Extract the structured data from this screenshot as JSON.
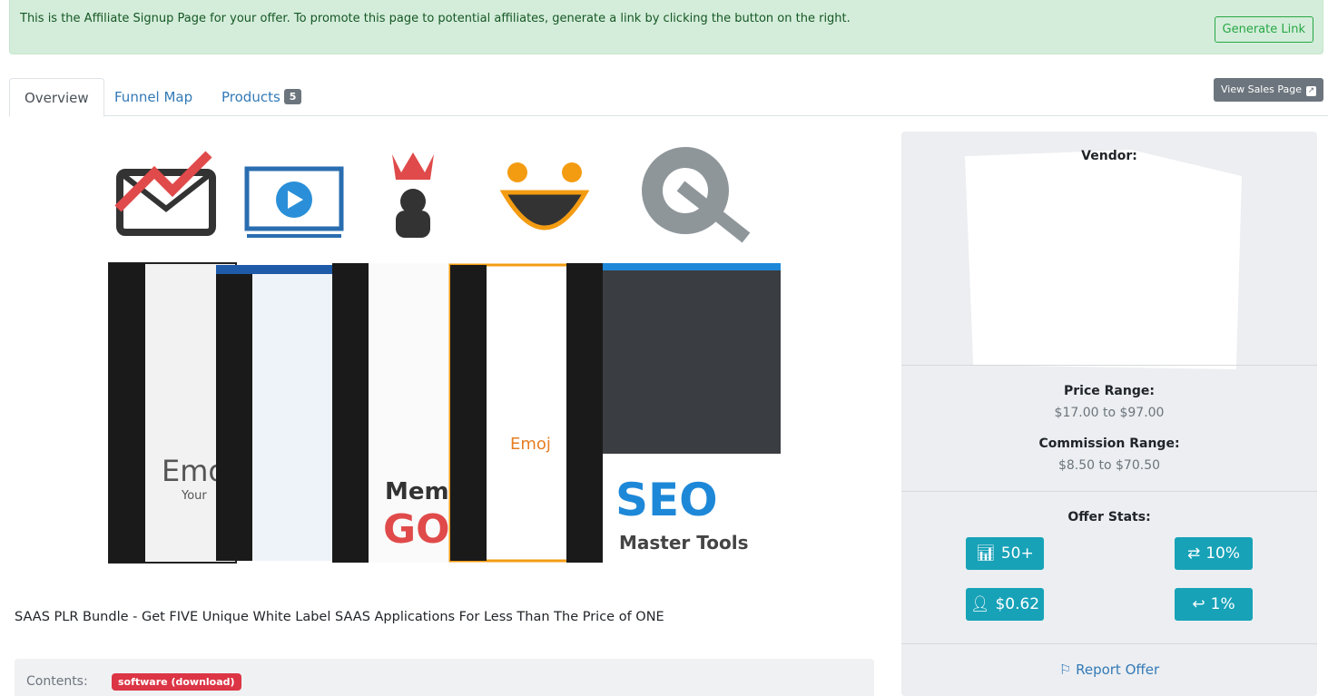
{
  "alert": {
    "text": "This is the Affiliate Signup Page for your offer. To promote this page to potential affiliates, generate a link by clicking the button on the right.",
    "button": "Generate Link"
  },
  "tabs": [
    {
      "label": "Overview",
      "active": true
    },
    {
      "label": "Funnel Map"
    },
    {
      "label": "Products",
      "badge": "5"
    }
  ],
  "view_sales_page": "View Sales Page",
  "product": {
    "title": "SAAS PLR Bundle - Get FIVE Unique White Label SAAS Applications For Less Than The Price of ONE",
    "contents_label": "Contents:",
    "contents_tag": "software (download)",
    "image_lettering": [
      "Emo",
      "Your",
      "Meme",
      "GO",
      "Emoj",
      "SEO",
      "Master Tools"
    ]
  },
  "sidebar": {
    "vendor_label": "Vendor:",
    "price_label": "Price Range:",
    "price_value": "$17.00 to $97.00",
    "commission_label": "Commission Range:",
    "commission_value": "$8.50 to $70.50",
    "stats_label": "Offer Stats:",
    "stats": [
      {
        "icon": "bar-chart-icon",
        "value": "50+"
      },
      {
        "icon": "exchange-icon",
        "value": "10%"
      },
      {
        "icon": "user-icon",
        "value": "$0.62"
      },
      {
        "icon": "reply-icon",
        "value": "1%"
      }
    ],
    "report": "Report Offer"
  },
  "colors": {
    "accent": "#17a2b8",
    "success": "#28a745",
    "danger": "#dc3545",
    "link": "#337ab7"
  }
}
